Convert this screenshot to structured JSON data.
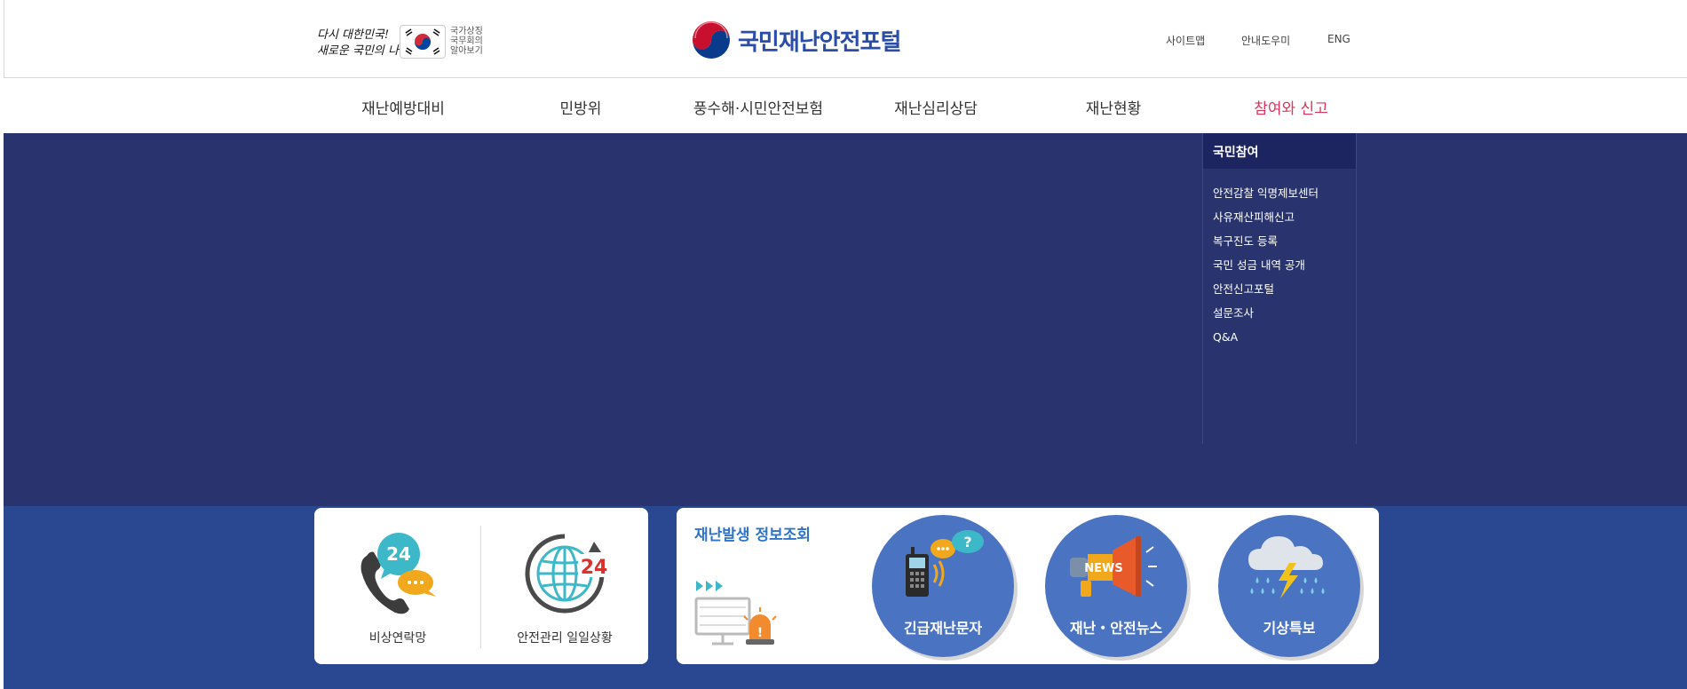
{
  "header": {
    "slogan": {
      "line1": "다시 대한민국!",
      "line2": "새로운 국민의 나라"
    },
    "flag_caption": [
      "국가상징",
      "국무회의",
      "알아보기"
    ],
    "site_title": "국민재난안전포털",
    "util_links": [
      "사이트맵",
      "안내도우미",
      "ENG"
    ]
  },
  "nav": {
    "items": [
      "재난예방대비",
      "민방위",
      "풍수해·시민안전보험",
      "재난심리상담",
      "재난현황",
      "참여와 신고"
    ],
    "active_index": 5
  },
  "submenu": {
    "title": "국민참여",
    "items": [
      "안전감찰 익명제보센터",
      "사유재산피해신고",
      "복구진도 등록",
      "국민 성금 내역 공개",
      "안전신고포털",
      "설문조사",
      "Q&A"
    ]
  },
  "quick_services": [
    {
      "label": "비상연락망",
      "icon": "phone-24-icon"
    },
    {
      "label": "안전관리 일일상황",
      "icon": "globe-24-icon"
    }
  ],
  "disaster_info": {
    "title": "재난발생 정보조회",
    "items": [
      {
        "label": "긴급재난문자",
        "icon": "emergency-radio-icon"
      },
      {
        "label": "재난・안전뉴스",
        "icon": "news-megaphone-icon",
        "icon_text": "NEWS"
      },
      {
        "label": "기상특보",
        "icon": "storm-cloud-icon"
      }
    ]
  },
  "colors": {
    "brand_blue": "#2a4ea8",
    "active_nav": "#e0345a",
    "mega_bg": "#29336e",
    "band_bg": "#2a4791",
    "circle_bg": "#4a73c2"
  }
}
